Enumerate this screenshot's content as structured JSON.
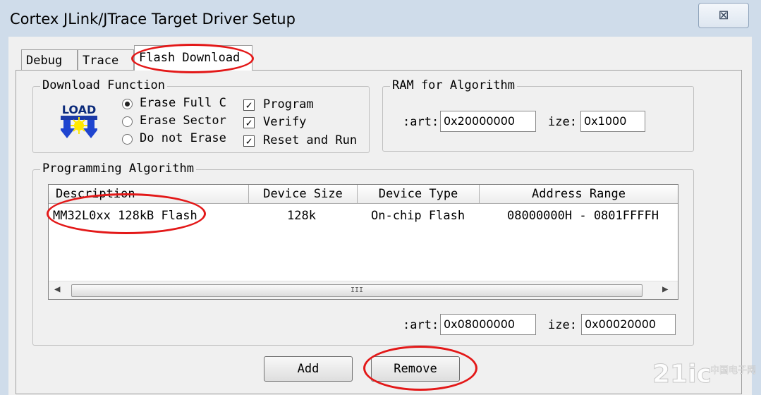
{
  "window": {
    "title": "Cortex JLink/JTrace Target Driver Setup",
    "close_glyph": "⊠"
  },
  "tabs": [
    {
      "label": "Debug"
    },
    {
      "label": "Trace"
    },
    {
      "label": "Flash Download",
      "selected": true
    }
  ],
  "download_function": {
    "group_title": "Download Function",
    "logo_text": "LOAD",
    "erase_options": [
      {
        "label": "Erase Full C",
        "selected": true
      },
      {
        "label": "Erase Sector",
        "selected": false
      },
      {
        "label": "Do not Erase",
        "selected": false
      }
    ],
    "actions": [
      {
        "label": "Program",
        "checked": true
      },
      {
        "label": "Verify",
        "checked": true
      },
      {
        "label": "Reset and Run",
        "checked": true
      }
    ]
  },
  "ram_for_algorithm": {
    "group_title": "RAM for Algorithm",
    "start_label": ":art:",
    "start_value": "0x20000000",
    "size_label": "ize:",
    "size_value": "0x1000"
  },
  "programming_algorithm": {
    "group_title": "Programming Algorithm",
    "columns": [
      "Description",
      "Device Size",
      "Device Type",
      "Address Range"
    ],
    "rows": [
      {
        "description": "MM32L0xx 128kB Flash",
        "device_size": "128k",
        "device_type": "On-chip Flash",
        "address_range": "08000000H - 0801FFFFH"
      }
    ],
    "scroll_thumb_glyph": "III",
    "start_label": ":art:",
    "start_value": "0x08000000",
    "size_label": "ize:",
    "size_value": "0x00020000"
  },
  "buttons": {
    "add": "Add",
    "remove": "Remove"
  },
  "watermark": {
    "text": "21ic",
    "sub": "中国电子网"
  },
  "colors": {
    "annotation_red": "#e31818",
    "title_bar": "#cfdcea",
    "dialog_bg": "#f0f0f0"
  }
}
